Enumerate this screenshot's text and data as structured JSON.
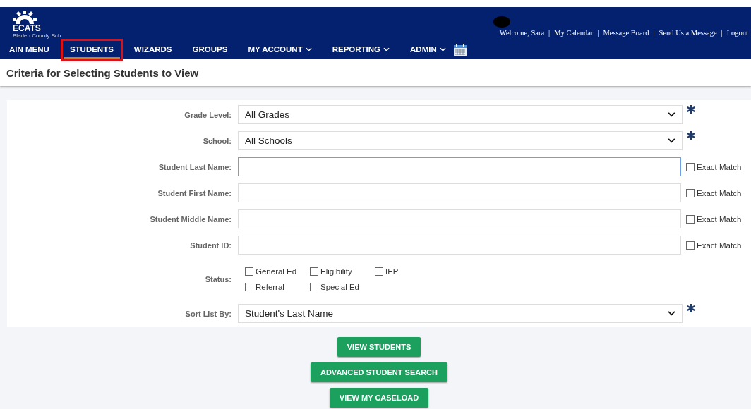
{
  "logo": {
    "name": "ECATS",
    "subtitle": "Bladen County Sch"
  },
  "link_separator": "|",
  "user_links": [
    {
      "label": "Welcome, Sara"
    },
    {
      "label": "My Calendar"
    },
    {
      "label": "Message Board"
    },
    {
      "label": "Send Us a Message"
    },
    {
      "label": "Logout"
    }
  ],
  "nav": [
    {
      "label": "AIN MENU",
      "selected": false,
      "dropdown": false
    },
    {
      "label": "STUDENTS",
      "selected": true,
      "dropdown": false
    },
    {
      "label": "WIZARDS",
      "selected": false,
      "dropdown": false
    },
    {
      "label": "GROUPS",
      "selected": false,
      "dropdown": false
    },
    {
      "label": "MY ACCOUNT",
      "selected": false,
      "dropdown": true
    },
    {
      "label": "REPORTING",
      "selected": false,
      "dropdown": true
    },
    {
      "label": "ADMIN",
      "selected": false,
      "dropdown": true
    }
  ],
  "page_title": "Criteria for Selecting Students to View",
  "form": [
    {
      "kind": "select",
      "label": "Grade Level:",
      "value": "All Grades",
      "required": true
    },
    {
      "kind": "select",
      "label": "School:",
      "value": "All Schools",
      "required": true
    },
    {
      "kind": "text",
      "label": "Student Last Name:",
      "focused": true,
      "exact_match": {
        "label": "Exact Match",
        "checked": false
      }
    },
    {
      "kind": "text",
      "label": "Student First Name:",
      "focused": false,
      "exact_match": {
        "label": "Exact Match",
        "checked": false
      }
    },
    {
      "kind": "text",
      "label": "Student Middle Name:",
      "focused": false,
      "exact_match": {
        "label": "Exact Match",
        "checked": false
      }
    },
    {
      "kind": "text",
      "label": "Student ID:",
      "focused": false,
      "exact_match": {
        "label": "Exact Match",
        "checked": false
      }
    },
    {
      "kind": "checks",
      "label": "Status:",
      "options": [
        [
          {
            "label": "General Ed",
            "checked": false
          },
          {
            "label": "Eligibility",
            "checked": false
          },
          {
            "label": "IEP",
            "checked": false
          }
        ],
        [
          {
            "label": "Referral",
            "checked": false
          },
          {
            "label": "Special Ed",
            "checked": false
          }
        ]
      ]
    },
    {
      "kind": "select",
      "label": "Sort List By:",
      "value": "Student's Last Name",
      "required": true
    }
  ],
  "buttons": [
    "VIEW STUDENTS",
    "ADVANCED STUDENT SEARCH",
    "VIEW MY CASELOAD"
  ]
}
